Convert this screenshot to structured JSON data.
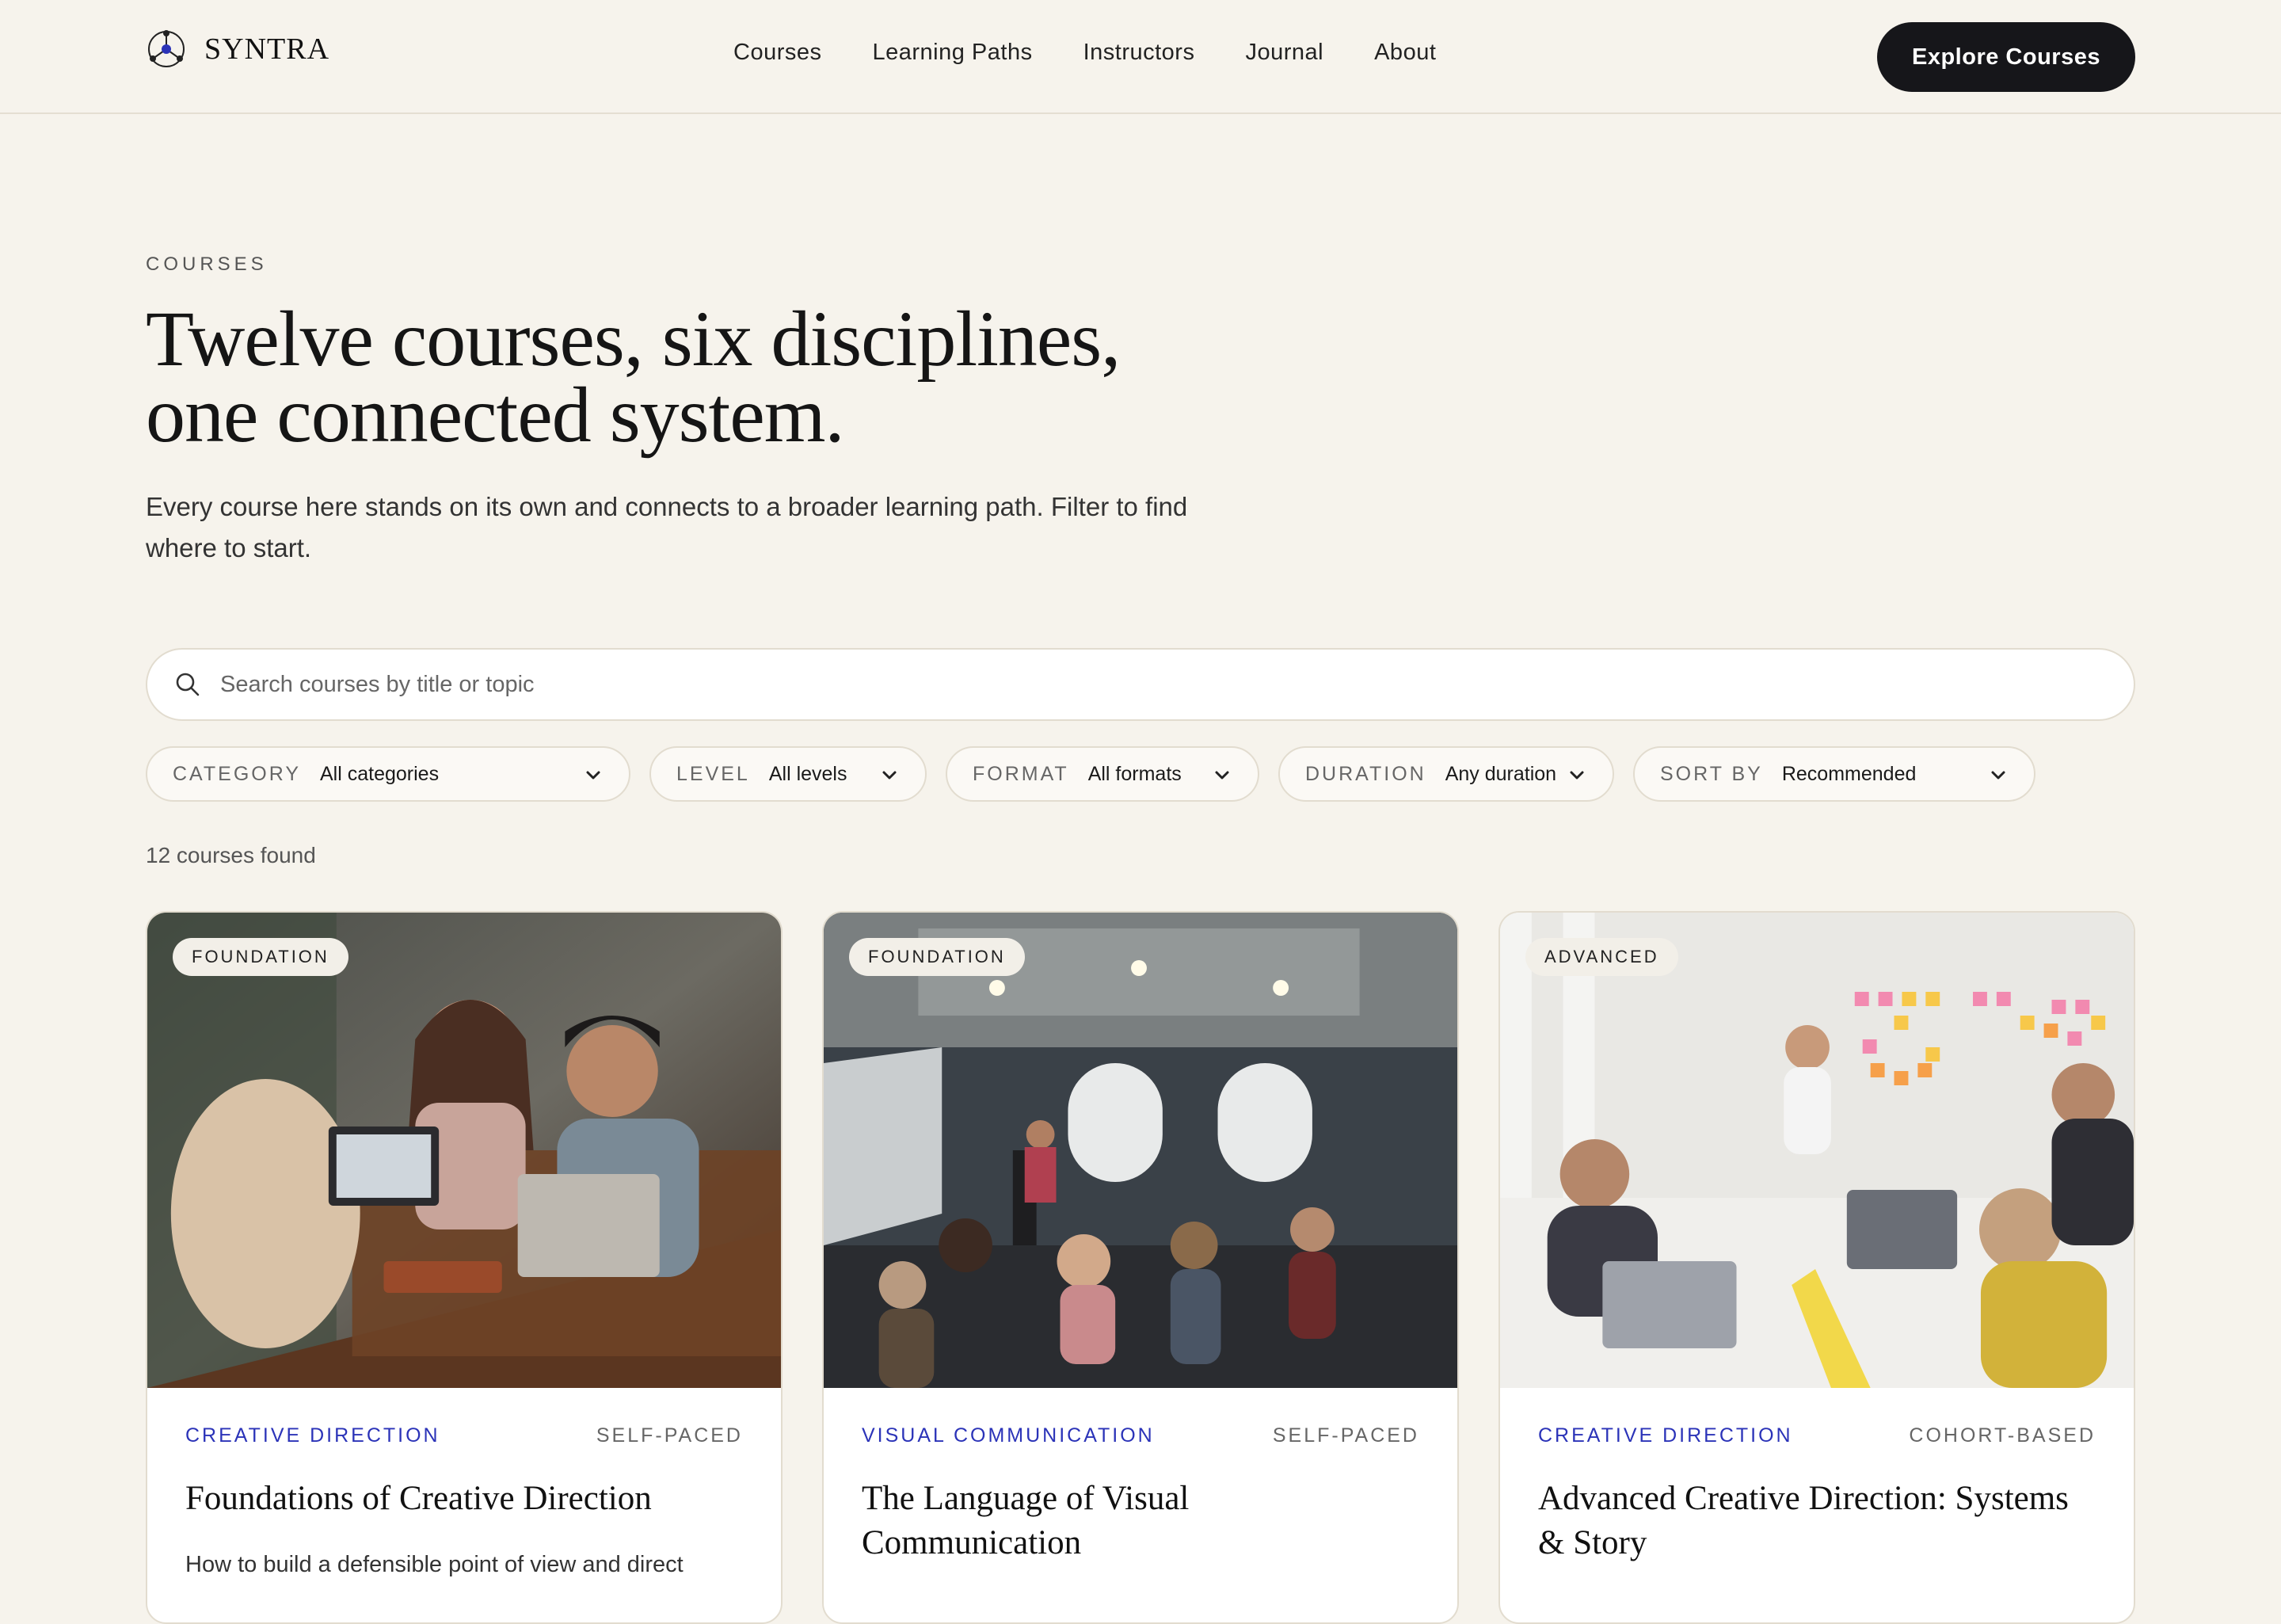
{
  "brand": {
    "name": "SYNTRA",
    "logo_icon": "network-node-icon",
    "accent": "#2b33b8"
  },
  "nav": {
    "items": [
      "Courses",
      "Learning Paths",
      "Instructors",
      "Journal",
      "About"
    ],
    "cta_label": "Explore Courses"
  },
  "hero": {
    "eyebrow": "COURSES",
    "title_line1": "Twelve courses, six disciplines,",
    "title_line2": "one connected system.",
    "subtitle": "Every course here stands on its own and connects to a broader learning path. Filter to find where to start."
  },
  "search": {
    "placeholder": "Search courses by title or topic",
    "value": ""
  },
  "filters": [
    {
      "label": "CATEGORY",
      "value": "All categories"
    },
    {
      "label": "LEVEL",
      "value": "All levels"
    },
    {
      "label": "FORMAT",
      "value": "All formats"
    },
    {
      "label": "DURATION",
      "value": "Any duration"
    },
    {
      "label": "SORT BY",
      "value": "Recommended"
    }
  ],
  "results_count": "12 courses found",
  "courses": [
    {
      "level": "FOUNDATION",
      "category": "CREATIVE DIRECTION",
      "format": "SELF-PACED",
      "title": "Foundations of Creative Direction",
      "description": "How to build a defensible point of view and direct",
      "image": "team-laughing-around-laptops"
    },
    {
      "level": "FOUNDATION",
      "category": "VISUAL COMMUNICATION",
      "format": "SELF-PACED",
      "title": "The Language of Visual Communication",
      "description": "",
      "image": "lecture-hall-presentation"
    },
    {
      "level": "ADVANCED",
      "category": "CREATIVE DIRECTION",
      "format": "COHORT-BASED",
      "title": "Advanced Creative Direction: Systems & Story",
      "description": "",
      "image": "workshop-sticky-notes-wall"
    }
  ]
}
